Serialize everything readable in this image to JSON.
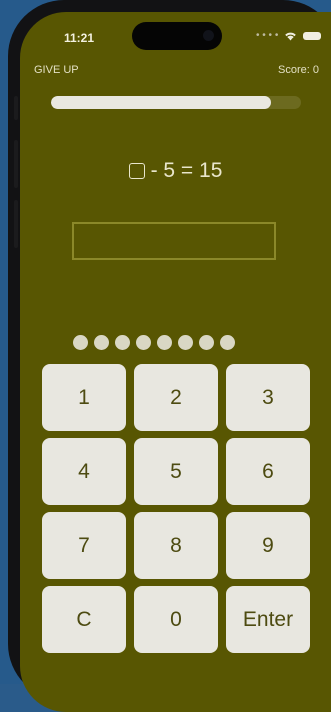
{
  "status_bar": {
    "time": "11:21",
    "signal_icon": "signal-dots-icon",
    "wifi_icon": "wifi-icon",
    "battery_icon": "battery-icon"
  },
  "header": {
    "give_up_label": "GIVE UP",
    "score_label": "Score: 0"
  },
  "progress": {
    "fraction": 0.88,
    "fill_color": "#e9e8e0",
    "track_color": "#6c6a1f"
  },
  "question": {
    "left_text": "- 5 = 15",
    "blank_icon": "blank-square-icon"
  },
  "answer": {
    "value": "",
    "placeholder": ""
  },
  "attempts": {
    "count": 8,
    "icon": "attempt-dot-icon"
  },
  "keypad": {
    "keys": [
      "1",
      "2",
      "3",
      "4",
      "5",
      "6",
      "7",
      "8",
      "9",
      "C",
      "0",
      "Enter"
    ]
  },
  "colors": {
    "screen_background": "#585602",
    "key_background": "#e8e7e0",
    "key_text": "#4d4b11",
    "input_border": "#8b8829"
  }
}
